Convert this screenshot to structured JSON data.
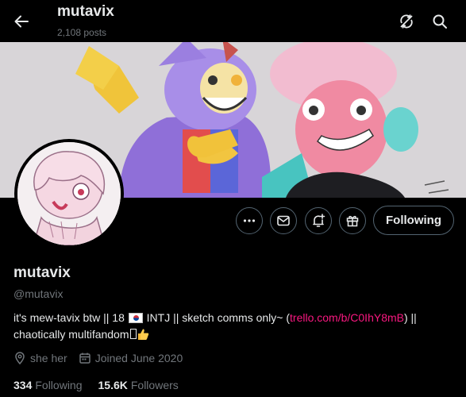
{
  "header": {
    "title": "mutavix",
    "posts_count": "2,108 posts",
    "back_icon": "arrow-left-icon",
    "sync_icon": "refresh-off-icon",
    "search_icon": "search-icon"
  },
  "profile": {
    "name": "mutavix",
    "handle": "@mutavix",
    "bio": {
      "part1": "it's mew-tavix btw || 18 ",
      "part2": " INTJ || sketch comms only~ (",
      "link": "trello.com/b/C0IhY8mB",
      "part3": ") ||",
      "part4": "chaotically multifandom"
    },
    "location": "she her",
    "joined": "Joined June 2020",
    "following_count": "334",
    "following_label": "Following",
    "followers_count": "15.6K",
    "followers_label": "Followers"
  },
  "actions": {
    "more_icon": "more-icon",
    "message_icon": "envelope-icon",
    "notify_icon": "bell-plus-icon",
    "subscribe_icon": "gift-icon",
    "follow_label": "Following"
  },
  "colors": {
    "background": "#000000",
    "text": "#e7e9ea",
    "muted": "#71767b",
    "border": "#536471",
    "link": "#f91880"
  }
}
